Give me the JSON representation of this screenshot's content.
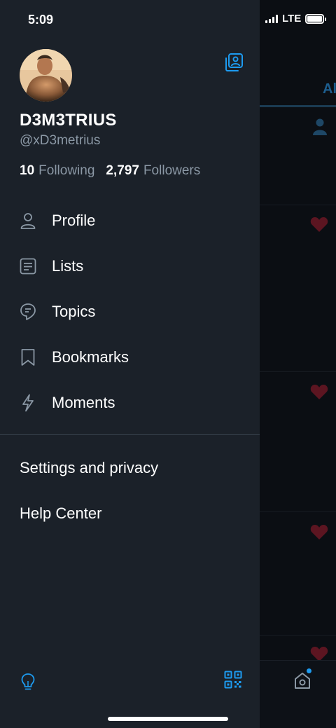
{
  "status_bar": {
    "time": "5:09",
    "network": "LTE"
  },
  "background": {
    "tab_partial": "Al"
  },
  "profile": {
    "display_name": "D3M3TRIUS",
    "handle": "@xD3metrius",
    "following_count": "10",
    "following_label": "Following",
    "followers_count": "2,797",
    "followers_label": "Followers"
  },
  "menu": {
    "items": [
      {
        "label": "Profile",
        "icon": "person-icon"
      },
      {
        "label": "Lists",
        "icon": "list-icon"
      },
      {
        "label": "Topics",
        "icon": "topics-icon"
      },
      {
        "label": "Bookmarks",
        "icon": "bookmark-icon"
      },
      {
        "label": "Moments",
        "icon": "lightning-icon"
      }
    ]
  },
  "secondary": {
    "settings": "Settings and privacy",
    "help": "Help Center"
  },
  "colors": {
    "drawer_bg": "#1b2129",
    "accent": "#1d9bf0",
    "muted_text": "#8b98a5",
    "heart": "#5c1521"
  },
  "icons": {
    "account_switch": "account-switch-icon",
    "bulb": "lightbulb-icon",
    "qr": "qr-code-icon",
    "home": "home-icon"
  }
}
